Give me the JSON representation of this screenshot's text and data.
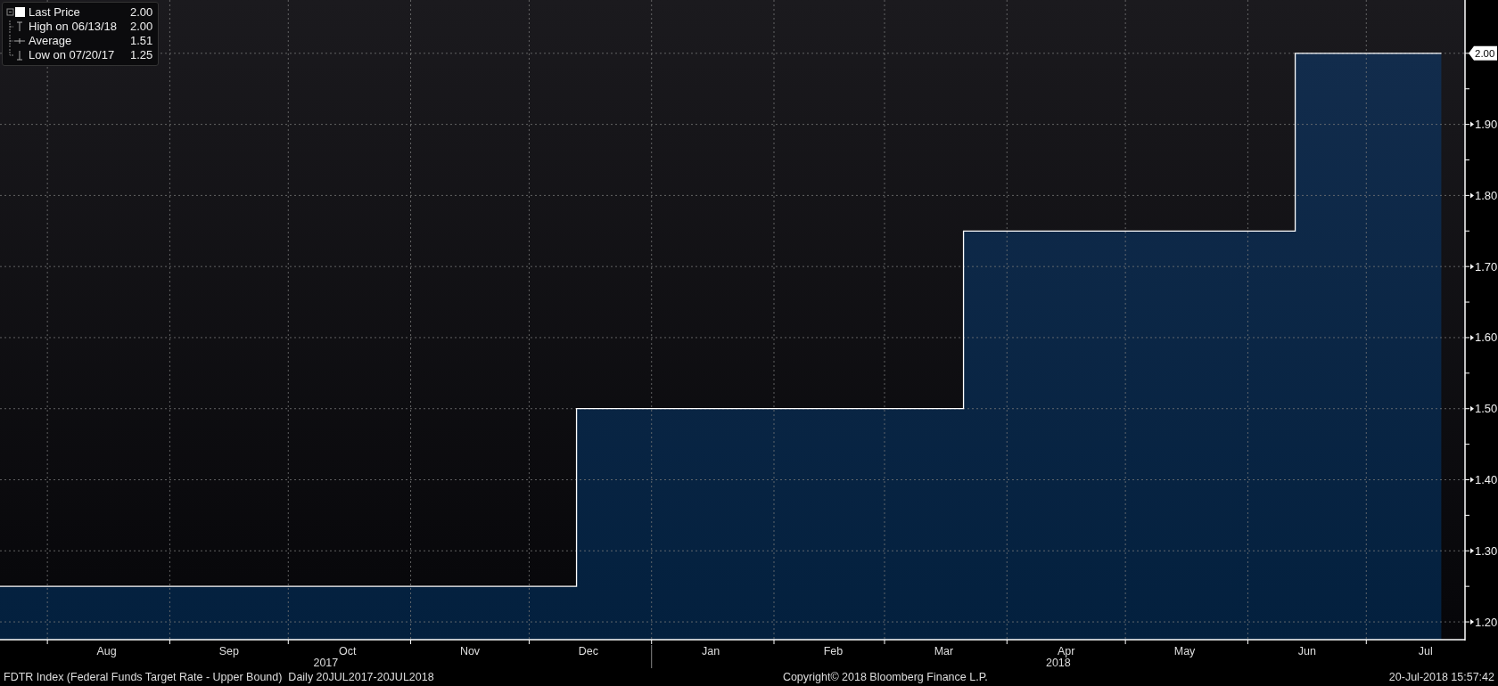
{
  "chart": {
    "legend": [
      {
        "kind": "last_price",
        "value": "2.00"
      },
      {
        "kind": "high",
        "label": "High on 06/13/18",
        "value": "2.00"
      },
      {
        "kind": "average",
        "label": "Average",
        "value": "1.51"
      },
      {
        "kind": "low",
        "label": "Low on 07/20/17",
        "value": "1.25"
      }
    ],
    "last_value_tag": "2.00",
    "year_labels": [
      "2017",
      "2018"
    ],
    "chart_data": {
      "type": "area",
      "grid": true,
      "x": [
        "2017-07-20",
        "2017-12-13",
        "2017-12-13",
        "2018-03-21",
        "2018-03-21",
        "2018-06-13",
        "2018-06-13",
        "2018-07-20"
      ],
      "series": [
        {
          "name": "Last Price",
          "color": "#ffffff",
          "values": [
            1.25,
            1.25,
            1.5,
            1.5,
            1.75,
            1.75,
            2.0,
            2.0
          ]
        }
      ],
      "xlim": [
        "2017-07-20",
        "2018-07-26"
      ],
      "ylim": [
        1.175,
        2.075
      ],
      "xticks": [
        {
          "value": "2017-08-16",
          "label": "Aug"
        },
        {
          "value": "2017-09-16",
          "label": "Sep"
        },
        {
          "value": "2017-10-16",
          "label": "Oct"
        },
        {
          "value": "2017-11-16",
          "label": "Nov"
        },
        {
          "value": "2017-12-16",
          "label": "Dec"
        },
        {
          "value": "2018-01-16",
          "label": "Jan"
        },
        {
          "value": "2018-02-16",
          "label": "Feb"
        },
        {
          "value": "2018-03-16",
          "label": "Mar"
        },
        {
          "value": "2018-04-16",
          "label": "Apr"
        },
        {
          "value": "2018-05-16",
          "label": "May"
        },
        {
          "value": "2018-06-16",
          "label": "Jun"
        },
        {
          "value": "2018-07-16",
          "label": "Jul"
        }
      ],
      "yticks": [
        {
          "value": 1.2,
          "label": "1.20"
        },
        {
          "value": 1.3,
          "label": "1.30"
        },
        {
          "value": 1.4,
          "label": "1.40"
        },
        {
          "value": 1.5,
          "label": "1.50"
        },
        {
          "value": 1.6,
          "label": "1.60"
        },
        {
          "value": 1.7,
          "label": "1.70"
        },
        {
          "value": 1.8,
          "label": "1.80"
        },
        {
          "value": 1.9,
          "label": "1.90"
        }
      ]
    }
  },
  "footer": {
    "title": "FDTR Index (Federal Funds Target Rate - Upper Bound)  Daily 20JUL2017-20JUL2018",
    "copyright": "Copyright© 2018 Bloomberg Finance L.P.",
    "timestamp": "20-Jul-2018 15:57:42"
  }
}
